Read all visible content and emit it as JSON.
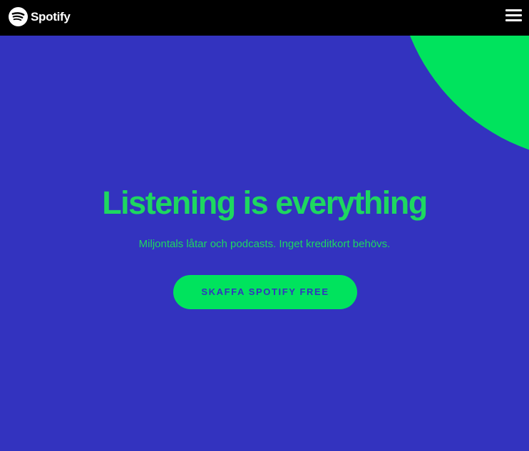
{
  "navbar": {
    "logo_text": "Spotify",
    "logo_icon": "spotify-logo-icon",
    "menu_icon": "hamburger-menu-icon",
    "background": "#000000"
  },
  "hero": {
    "title": "Listening is everything",
    "subtitle": "Miljontals låtar och podcasts. Inget kreditkort behövs.",
    "cta_label": "SKAFFA SPOTIFY FREE",
    "background": "#3333bf",
    "accent": "#1ed760",
    "circle_color": "#00e35d"
  }
}
